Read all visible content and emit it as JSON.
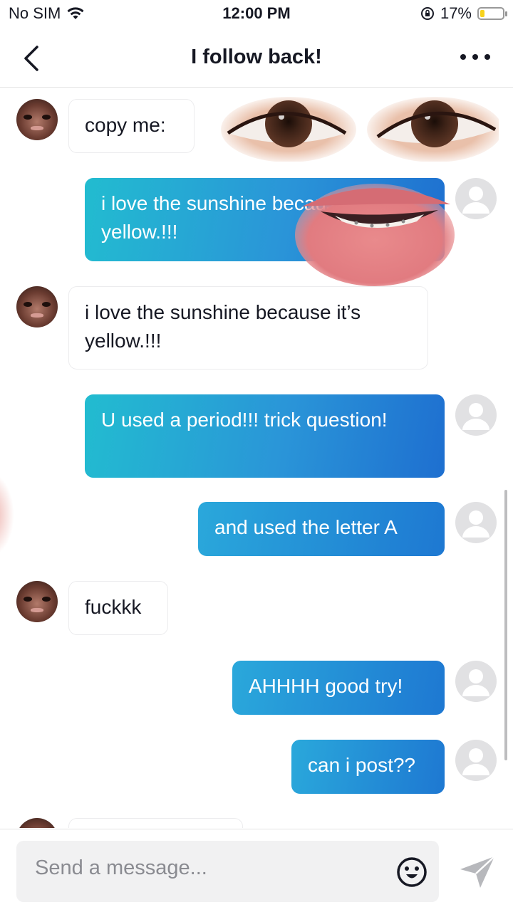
{
  "status_bar": {
    "carrier": "No SIM",
    "time": "12:00 PM",
    "battery_percent": "17%",
    "battery_level": 0.17
  },
  "header": {
    "title": "I follow back!",
    "back_icon": "chevron-left-icon",
    "more_icon": "more-horizontal-icon"
  },
  "messages": [
    {
      "from": "them",
      "text": "copy me:"
    },
    {
      "from": "me",
      "text": "i love the sunshine because it’s yellow.!!!"
    },
    {
      "from": "them",
      "text": "i love the sunshine because it’s yellow.!!!"
    },
    {
      "from": "me",
      "text": "U used a period!!! trick question!"
    },
    {
      "from": "me",
      "text": "and used the letter A"
    },
    {
      "from": "them",
      "text": "fuckkk"
    },
    {
      "from": "me",
      "text": "AHHHH good try!"
    },
    {
      "from": "me",
      "text": "can i post??"
    }
  ],
  "composer": {
    "placeholder": "Send a message...",
    "emoji_icon": "emoji-icon",
    "send_icon": "send-icon"
  },
  "colors": {
    "sent_gradient_start": "#22bcd0",
    "sent_gradient_end": "#1e6fd0"
  }
}
